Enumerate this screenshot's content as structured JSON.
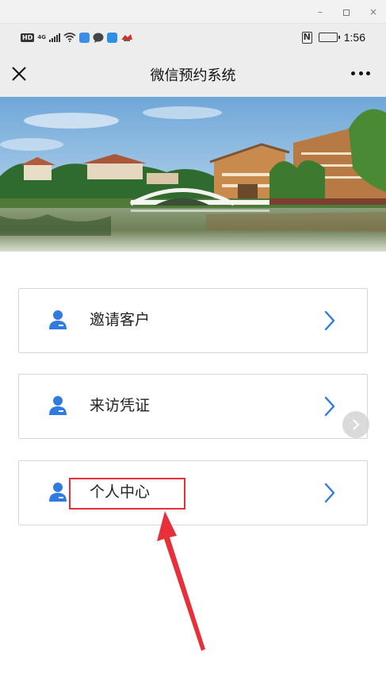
{
  "window": {
    "minimize": "–",
    "maximize": "",
    "close": "×"
  },
  "status_bar": {
    "hd": "HD",
    "network": "4G",
    "time": "1:56",
    "battery_level": 0.85,
    "app_icons": [
      "wifi-icon",
      "app-icon-blue",
      "chat-icon",
      "app-icon-cursor",
      "app-icon-bird"
    ]
  },
  "nav": {
    "title": "微信预约系统",
    "close_icon": "close-icon",
    "more_icon": "more-icon"
  },
  "menu": {
    "items": [
      {
        "label": "邀请客户",
        "icon": "user-icon"
      },
      {
        "label": "来访凭证",
        "icon": "user-icon"
      },
      {
        "label": "个人中心",
        "icon": "user-icon"
      }
    ]
  },
  "colors": {
    "accent": "#2f7be0",
    "highlight": "#e8303a",
    "nav_bg": "#ededed",
    "card_border": "#d6d6d6"
  }
}
